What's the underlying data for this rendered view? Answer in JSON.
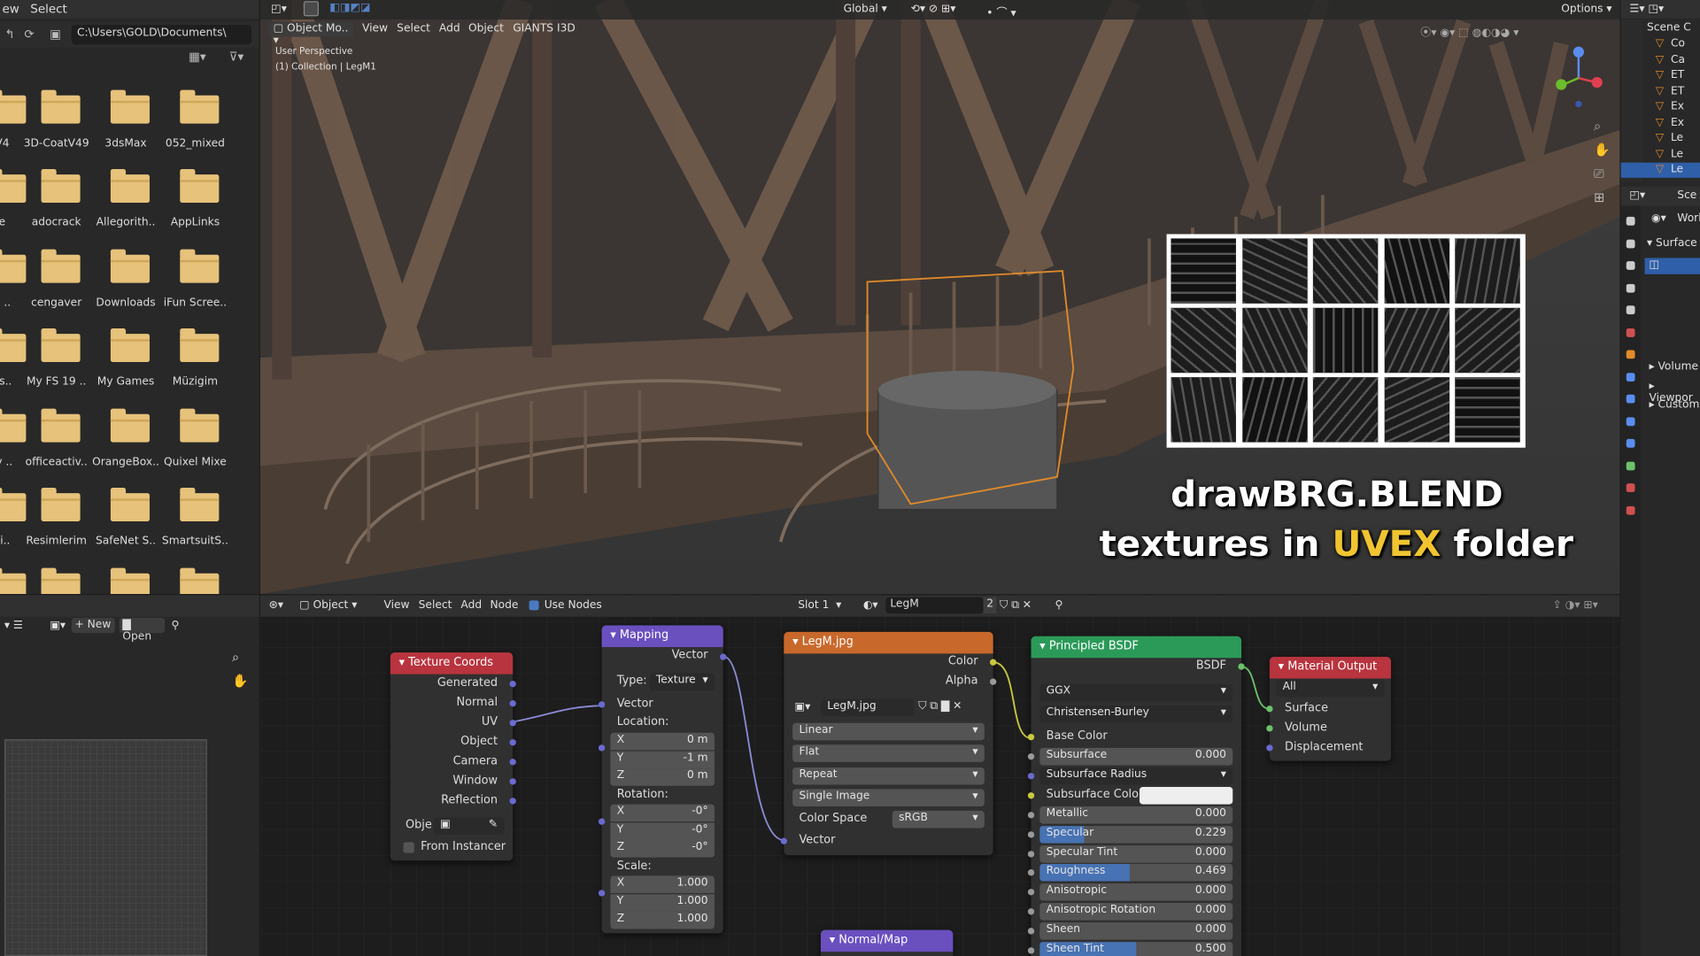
{
  "file_browser": {
    "menu": [
      "ew",
      "Select"
    ],
    "path": "C:\\Users\\GOLD\\Documents\\",
    "folders": [
      "V4",
      "3D-CoatV49",
      "3dsMax",
      "052_mixed",
      "e",
      "adocrack",
      "Allegorith..",
      "AppLinks",
      "h ..",
      "cengaver",
      "Downloads",
      "iFun Scree..",
      "ns..",
      "My FS 19 ..",
      "My Games",
      "Müzigim",
      "ty ..",
      "officeactiv..",
      "OrangeBox..",
      "Quixel Mixe",
      "ci..",
      "Resimlerim",
      "SafeNet S..",
      "SmartsuitS..",
      "",
      "",
      "",
      ""
    ]
  },
  "viewport": {
    "mode": "Object Mo..",
    "menu": [
      "View",
      "Select",
      "Add",
      "Object",
      "GIANTS I3D"
    ],
    "perspective": "User Perspective",
    "collection": "(1) Collection | LegM1",
    "orientation": "Global",
    "options": "Options",
    "overlay_title": "drawBRG.BLEND",
    "overlay_sub_pre": "textures in",
    "overlay_sub_hl": "UVEX",
    "overlay_sub_post": "folder"
  },
  "node_editor": {
    "mode": "Object",
    "menu": [
      "View",
      "Select",
      "Add",
      "Node"
    ],
    "use_nodes": "Use Nodes",
    "slot": "Slot 1",
    "material": "LegM",
    "users": "2",
    "left_new": "New",
    "left_open": "Open"
  },
  "nodes": {
    "tex_coords": {
      "title": "Texture Coords",
      "outputs": [
        "Generated",
        "Normal",
        "UV",
        "Object",
        "Camera",
        "Window",
        "Reflection"
      ],
      "obj_label": "Obje",
      "from_instancer": "From Instancer"
    },
    "mapping": {
      "title": "Mapping",
      "out": "Vector",
      "type_label": "Type:",
      "type_val": "Texture",
      "vector": "Vector",
      "location": "Location:",
      "loc": [
        [
          "X",
          "0 m"
        ],
        [
          "Y",
          "-1 m"
        ],
        [
          "Z",
          "0 m"
        ]
      ],
      "rotation": "Rotation:",
      "rot": [
        [
          "X",
          "-0°"
        ],
        [
          "Y",
          "-0°"
        ],
        [
          "Z",
          "-0°"
        ]
      ],
      "scale": "Scale:",
      "scl": [
        [
          "X",
          "1.000"
        ],
        [
          "Y",
          "1.000"
        ],
        [
          "Z",
          "1.000"
        ]
      ]
    },
    "image": {
      "title": "LegM.jpg",
      "color": "Color",
      "alpha": "Alpha",
      "img_name": "LegM.jpg",
      "interp": "Linear",
      "proj": "Flat",
      "ext": "Repeat",
      "src": "Single Image",
      "cs_label": "Color Space",
      "cs_val": "sRGB",
      "vector": "Vector"
    },
    "bsdf": {
      "title": "Principled BSDF",
      "out": "BSDF",
      "dist": "GGX",
      "sss_method": "Christensen-Burley",
      "base_color": "Base Color",
      "props": [
        [
          "Subsurface",
          "0.000",
          0
        ],
        [
          "Subsurface Radius",
          "",
          0
        ],
        [
          "Subsurface Color",
          "",
          0
        ],
        [
          "Metallic",
          "0.000",
          0
        ],
        [
          "Specular",
          "0.229",
          0.229
        ],
        [
          "Specular Tint",
          "0.000",
          0
        ],
        [
          "Roughness",
          "0.469",
          0.469
        ],
        [
          "Anisotropic",
          "0.000",
          0
        ],
        [
          "Anisotropic Rotation",
          "0.000",
          0
        ],
        [
          "Sheen",
          "0.000",
          0
        ],
        [
          "Sheen Tint",
          "0.500",
          0.5
        ]
      ]
    },
    "output": {
      "title": "Material Output",
      "target": "All",
      "inputs": [
        "Surface",
        "Volume",
        "Displacement"
      ]
    },
    "normalmap": {
      "title": "Normal/Map"
    }
  },
  "outliner": {
    "scene": "Scene C",
    "items": [
      "Co",
      "Ca",
      "ET",
      "ET",
      "Ex",
      "Ex",
      "Le",
      "Le",
      "Le"
    ],
    "sce": "Sce",
    "world": "Worl",
    "surface": "Surface",
    "sections": [
      "Volume",
      "Viewpor",
      "Custom"
    ]
  }
}
